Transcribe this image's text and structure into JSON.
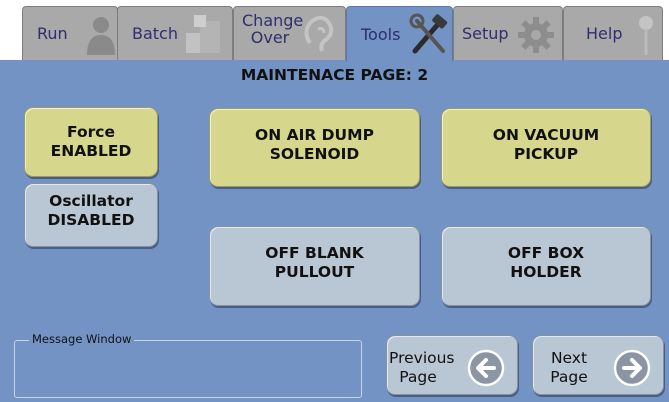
{
  "tabs": [
    {
      "label": "Run",
      "icon": "person-icon"
    },
    {
      "label": "Batch",
      "icon": "boxes-icon"
    },
    {
      "label": "Change\nOver",
      "icon": "ear-icon"
    },
    {
      "label": "Tools",
      "icon": "tools-icon",
      "active": true
    },
    {
      "label": "Setup",
      "icon": "gear-icon"
    },
    {
      "label": "Help",
      "icon": "pin-icon"
    }
  ],
  "page_title": "MAINTENACE PAGE: 2",
  "buttons": {
    "force": "Force\nENABLED",
    "oscillator": "Oscillator\nDISABLED",
    "air_dump": "ON AIR DUMP\nSOLENOID",
    "vacuum": "ON VACUUM\nPICKUP",
    "blank_pullout": "OFF BLANK\nPULLOUT",
    "box_holder": "OFF BOX\nHOLDER"
  },
  "message_window": {
    "label": "Message Window"
  },
  "nav": {
    "previous": "Previous\nPage",
    "next": "Next\nPage"
  },
  "colors": {
    "background": "#7393c4",
    "on_button": "#d6d68d",
    "off_button": "#b9c6d3",
    "tab_inactive": "#a9a9a9"
  }
}
